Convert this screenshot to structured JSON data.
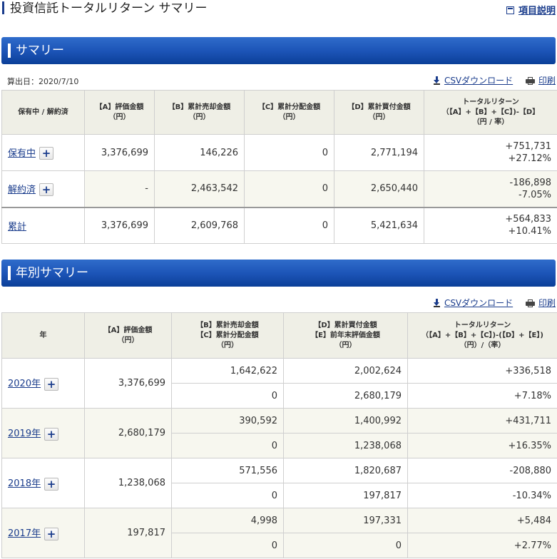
{
  "page": {
    "title": "投資信託トータルリターン サマリー",
    "help_label": "項目説明"
  },
  "summary": {
    "section_title": "サマリー",
    "calc_date": "算出日：2020/7/10",
    "csv_label": "CSVダウンロード",
    "print_label": "印刷",
    "headers": [
      "保有中 / 解約済",
      "【A】評価金額\n（円）",
      "【B】累計売却金額\n（円）",
      "【C】累計分配金額\n（円）",
      "【D】累計買付金額\n（円）",
      "トータルリターン\n（【A】+【B】+【C】)-【D】\n（円 / 率）"
    ],
    "rows": [
      {
        "label": "保有中",
        "a": "3,376,699",
        "b": "146,226",
        "c": "0",
        "d": "2,771,194",
        "ret": "+751,731",
        "rate": "+27.12%",
        "sign": "pos",
        "expand": "+"
      },
      {
        "label": "解約済",
        "a": "-",
        "b": "2,463,542",
        "c": "0",
        "d": "2,650,440",
        "ret": "-186,898",
        "rate": "-7.05%",
        "sign": "neg",
        "expand": "+"
      },
      {
        "label": "累計",
        "a": "3,376,699",
        "b": "2,609,768",
        "c": "0",
        "d": "5,421,634",
        "ret": "+564,833",
        "rate": "+10.41%",
        "sign": "pos",
        "expand": ""
      }
    ]
  },
  "yearly": {
    "section_title": "年別サマリー",
    "csv_label": "CSVダウンロード",
    "print_label": "印刷",
    "headers": [
      "年",
      "【A】評価金額\n（円）",
      "【B】累計売却金額\n【C】累計分配金額\n（円）",
      "【D】累計買付金額\n【E】前年末評価金額\n（円）",
      "トータルリターン\n（【A】+【B】+【C】)-(【D】+【E】)\n（円）/（率）"
    ],
    "rows": [
      {
        "year": "2020年",
        "a": "3,376,699",
        "b": "1,642,622",
        "c": "0",
        "d": "2,002,624",
        "e": "2,680,179",
        "ret": "+336,518",
        "rate": "+7.18%",
        "sign": "pos"
      },
      {
        "year": "2019年",
        "a": "2,680,179",
        "b": "390,592",
        "c": "0",
        "d": "1,400,992",
        "e": "1,238,068",
        "ret": "+431,711",
        "rate": "+16.35%",
        "sign": "pos"
      },
      {
        "year": "2018年",
        "a": "1,238,068",
        "b": "571,556",
        "c": "0",
        "d": "1,820,687",
        "e": "197,817",
        "ret": "-208,880",
        "rate": "-10.34%",
        "sign": "neg"
      },
      {
        "year": "2017年",
        "a": "197,817",
        "b": "4,998",
        "c": "0",
        "d": "197,331",
        "e": "0",
        "ret": "+5,484",
        "rate": "+2.77%",
        "sign": "pos"
      }
    ]
  }
}
